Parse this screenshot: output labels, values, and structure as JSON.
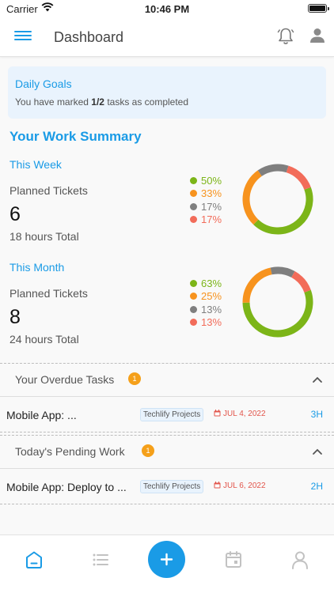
{
  "status_bar": {
    "carrier": "Carrier",
    "time": "10:46 PM"
  },
  "header": {
    "title": "Dashboard"
  },
  "daily_goals": {
    "title": "Daily Goals",
    "text_before": "You have marked ",
    "completed": "1/2",
    "text_after": " tasks as completed"
  },
  "summary": {
    "title": "Your Work Summary",
    "periods": [
      {
        "label": "This Week",
        "planned_label": "Planned Tickets",
        "count": "6",
        "hours": "18 hours Total",
        "legend": [
          "50%",
          "33%",
          "17%",
          "17%"
        ],
        "segments": [
          50,
          33,
          17,
          17
        ]
      },
      {
        "label": "This Month",
        "planned_label": "Planned Tickets",
        "count": "8",
        "hours": "24 hours Total",
        "legend": [
          "63%",
          "25%",
          "13%",
          "13%"
        ],
        "segments": [
          63,
          25,
          13,
          13
        ]
      }
    ]
  },
  "colors": {
    "accent": "#1a9be6",
    "green": "#7cb518",
    "orange": "#f7931e",
    "gray": "#7f7f7f",
    "red": "#f26c5a",
    "badge": "#f5a01a",
    "date_red": "#e2554b"
  },
  "overdue": {
    "title": "Your Overdue Tasks",
    "count": "1",
    "tasks": [
      {
        "name": "Mobile App: ...",
        "project": "Techlify Projects",
        "date": "JUL 4, 2022",
        "estimate": "3H"
      }
    ]
  },
  "pending": {
    "title": "Today's Pending Work",
    "count": "1",
    "tasks": [
      {
        "name": "Mobile App: Deploy to ...",
        "project": "Techlify Projects",
        "date": "JUL 6, 2022",
        "estimate": "2H"
      }
    ]
  },
  "bottom_nav": {
    "items": [
      "home-icon",
      "list-icon",
      "add-icon",
      "calendar-icon",
      "profile-icon"
    ],
    "active": "home-icon"
  }
}
